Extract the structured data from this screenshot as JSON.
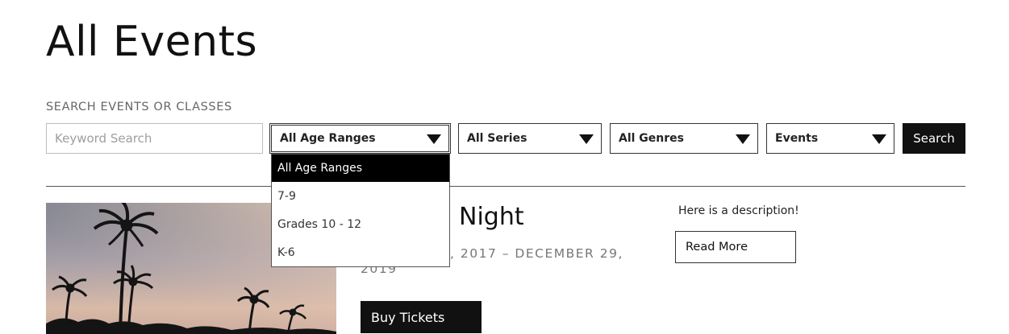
{
  "page": {
    "title": "All Events"
  },
  "filters": {
    "heading": "SEARCH EVENTS OR CLASSES",
    "keyword_placeholder": "Keyword Search",
    "age_range": {
      "selected": "All Age Ranges",
      "options": [
        "All Age Ranges",
        "7-9",
        "Grades 10 - 12",
        "K-6"
      ]
    },
    "series": {
      "selected": "All Series"
    },
    "genres": {
      "selected": "All Genres"
    },
    "type": {
      "selected": "Events"
    },
    "search_label": "Search"
  },
  "event": {
    "title_visible": "Night",
    "dates_visible_line1": ", 2017 – DECEMBER 29,",
    "dates_visible_line2": "2019",
    "description": "Here is a description!",
    "read_more_label": "Read More",
    "buy_label": "Buy Tickets"
  },
  "colors": {
    "accent": "#111111",
    "muted_text": "#777777",
    "border": "#333333"
  },
  "icons": {
    "select_caret": "caret-down-icon"
  }
}
